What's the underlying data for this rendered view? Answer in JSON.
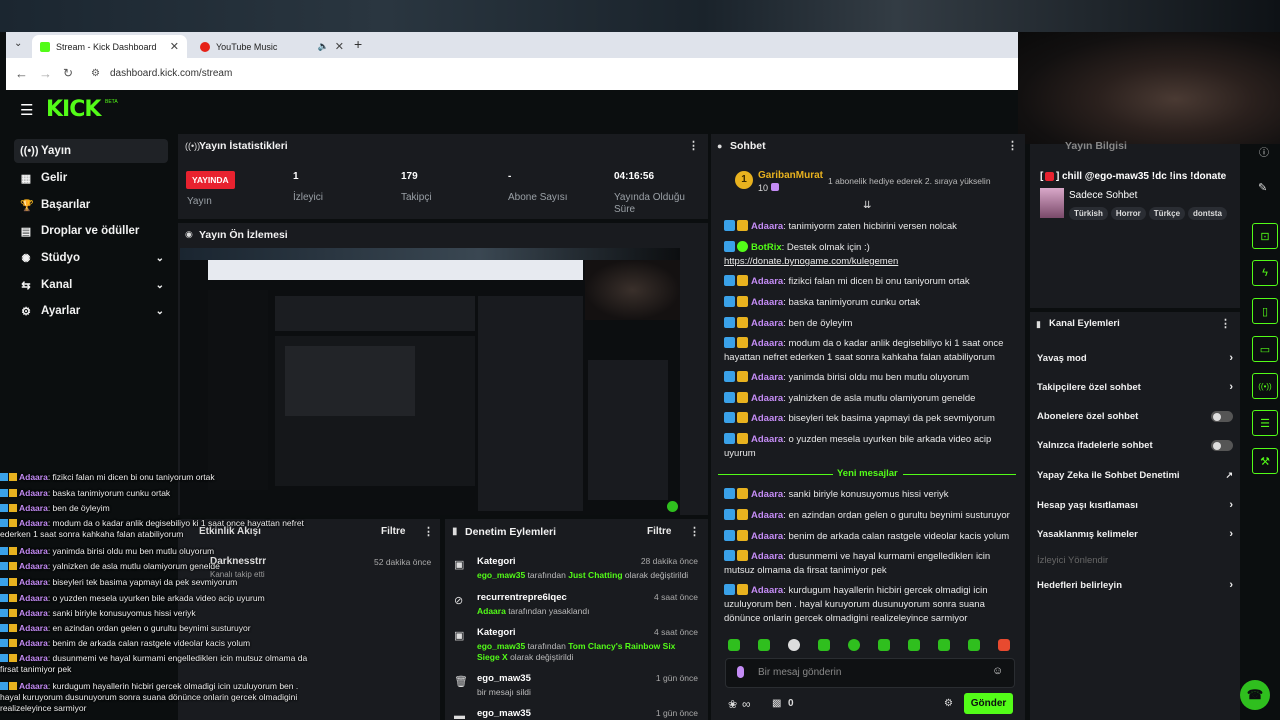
{
  "browser": {
    "tabs": [
      {
        "title": "Stream - Kick Dashboard"
      },
      {
        "title": "YouTube Music"
      }
    ],
    "new_tab": "+",
    "url": "dashboard.kick.com/stream"
  },
  "topbar": {
    "logo": "KICK",
    "beta": "BETA"
  },
  "sidebar": {
    "items": [
      {
        "label": "Yayın"
      },
      {
        "label": "Gelir"
      },
      {
        "label": "Başarılar"
      },
      {
        "label": "Droplar ve ödüller"
      },
      {
        "label": "Stüdyo"
      },
      {
        "label": "Kanal"
      },
      {
        "label": "Ayarlar"
      }
    ]
  },
  "stats": {
    "title": "Yayın İstatistikleri",
    "live": "YAYINDA",
    "live_label": "Yayın",
    "viewers": "1",
    "viewers_label": "İzleyici",
    "followers": "179",
    "followers_label": "Takipçi",
    "subs": "-",
    "subs_label": "Abone Sayısı",
    "uptime": "04:16:56",
    "uptime_label": "Yayında Olduğu Süre"
  },
  "preview": {
    "title": "Yayın Ön İzlemesi"
  },
  "activity": {
    "filter": "Filtre",
    "title_overlay": "Etkinlik Akışı",
    "item_user": "Darknesstrr",
    "item_desc": "Kanalı takip etti",
    "item_time": "52 dakika önce"
  },
  "moderation": {
    "title": "Denetim Eylemleri",
    "filter": "Filtre",
    "items": [
      {
        "title": "Kategori",
        "time": "28 dakika önce",
        "user": "ego_maw35",
        "mid": " tarafından ",
        "value": "Just Chatting",
        "tail": " olarak değiştirildi"
      },
      {
        "title": "recurrentrepre6lqec",
        "time": "4 saat önce",
        "user": "Adaara",
        "mid": " tarafından yasaklandı",
        "value": "",
        "tail": ""
      },
      {
        "title": "Kategori",
        "time": "4 saat önce",
        "user": "ego_maw35",
        "mid": " tarafından ",
        "value": "Tom Clancy's Rainbow Six Siege X",
        "tail": " olarak değiştirildi"
      },
      {
        "title": "ego_maw35",
        "time": "1 gün önce",
        "user": "",
        "mid": "bir mesajı sildi",
        "value": "",
        "tail": ""
      },
      {
        "title": "ego_maw35",
        "time": "1 gün önce",
        "user": "",
        "mid": "",
        "value": "",
        "tail": ""
      }
    ]
  },
  "chat": {
    "title": "Sohbet",
    "pinned_user": "GaribanMurat",
    "pinned_count": "10",
    "pinned_rank": "1",
    "pinned_text": "1 abonelik hediye ederek 2. sıraya yükselin",
    "messages": [
      {
        "user": "Adaara",
        "text": ": tanimiyorm zaten hicbirini versen nolcak"
      },
      {
        "user": "BotRix",
        "text": ": Destek olmak için :) ",
        "link": "https://donate.bynogame.com/kulegemen"
      },
      {
        "user": "Adaara",
        "text": ": fizikci falan mi dicen bi onu taniyorum ortak"
      },
      {
        "user": "Adaara",
        "text": ": baska tanimiyorum cunku ortak"
      },
      {
        "user": "Adaara",
        "text": ": ben de öyleyim"
      },
      {
        "user": "Adaara",
        "text": ": modum da o kadar anlik degisebiliyo ki 1 saat once hayattan nefret ederken 1 saat sonra kahkaha falan atabiliyorum"
      },
      {
        "user": "Adaara",
        "text": ": yanimda birisi oldu mu ben mutlu oluyorum"
      },
      {
        "user": "Adaara",
        "text": ": yalnizken de asla mutlu olamiyorum genelde"
      },
      {
        "user": "Adaara",
        "text": ": biseyleri tek basima yapmayi da pek sevmiyorum"
      },
      {
        "user": "Adaara",
        "text": ": o yuzden mesela uyurken bile arkada video acip uyurum"
      }
    ],
    "new_messages": "Yeni mesajlar",
    "new": [
      {
        "user": "Adaara",
        "text": ": sanki biriyle konusuyomus hissi veriyk"
      },
      {
        "user": "Adaara",
        "text": ": en azindan ordan gelen o gurultu beynimi susturuyor"
      },
      {
        "user": "Adaara",
        "text": ": benim de arkada calan rastgele videolar kacis yolum"
      },
      {
        "user": "Adaara",
        "text": ": dusunmemi ve hayal kurmami engellediklerı icin mutsuz olmama da firsat tanimiyor pek"
      },
      {
        "user": "Adaara",
        "text": ": kurdugum hayallerin hicbiri gercek olmadigi icin uzuluyorum ben . hayal kuruyorum dusunuyorum sonra suana dönünce onlarin gercek olmadigini realizeleyince sarmiyor"
      }
    ],
    "input_placeholder": "Bir mesaj gönderin",
    "points": "∞",
    "gifts": "0",
    "send": "Gönder"
  },
  "stream_info": {
    "title_partial": "Yayın Bilgisi",
    "stream_title": "chill @ego-maw35 !dc !ins !donate",
    "category": "Sadece Sohbet",
    "tags": [
      "Türkish",
      "Horror",
      "Türkçe",
      "dontsta"
    ]
  },
  "channel_actions": {
    "title": "Kanal Eylemleri",
    "items": [
      {
        "label": "Yavaş mod",
        "kind": "chevron"
      },
      {
        "label": "Takipçilere özel sohbet",
        "kind": "chevron"
      },
      {
        "label": "Abonelere özel sohbet",
        "kind": "toggle"
      },
      {
        "label": "Yalnızca ifadelerle sohbet",
        "kind": "toggle"
      },
      {
        "label": "Yapay Zeka ile Sohbet Denetimi",
        "kind": "external"
      },
      {
        "label": "Hesap yaşı kısıtlaması",
        "kind": "chevron"
      },
      {
        "label": "Yasaklanmış kelimeler",
        "kind": "chevron"
      },
      {
        "label": "İzleyici Yönlendir",
        "kind": "disabled"
      },
      {
        "label": "Hedefleri belirleyin",
        "kind": "chevron"
      }
    ]
  },
  "overlay_chat": [
    {
      "user": "Adaara",
      "text": ": fizikci falan mi dicen bi onu taniyorum ortak"
    },
    {
      "user": "Adaara",
      "text": ": baska tanimiyorum cunku ortak"
    },
    {
      "user": "Adaara",
      "text": ": ben de öyleyim"
    },
    {
      "user": "Adaara",
      "text": ": modum da o kadar anlik degisebiliyo ki 1 saat once hayattan nefret ederken 1 saat sonra kahkaha falan atabiliyorum"
    },
    {
      "user": "Adaara",
      "text": ": yanimda birisi oldu mu ben mutlu oluyorum"
    },
    {
      "user": "Adaara",
      "text": ": yalnizken de asla mutlu olamiyorum genelde"
    },
    {
      "user": "Adaara",
      "text": ": biseyleri tek basima yapmayi da pek sevmiyorum"
    },
    {
      "user": "Adaara",
      "text": ": o yuzden mesela uyurken bile arkada video acip uyurum"
    },
    {
      "user": "Adaara",
      "text": ": sanki biriyle konusuyomus hissi veriyk"
    },
    {
      "user": "Adaara",
      "text": ": en azindan ordan gelen o gurultu beynimi susturuyor"
    },
    {
      "user": "Adaara",
      "text": ": benim de arkada calan rastgele videolar kacis yolum"
    },
    {
      "user": "Adaara",
      "text": ": dusunmemi ve hayal kurmami engellediklerı icin mutsuz olmama da firsat tanimiyor pek"
    },
    {
      "user": "Adaara",
      "text": ": kurdugum hayallerin hicbiri gercek olmadigi icin uzuluyorum ben . hayal kuruyorum dusunuyorum sonra suana dönünce onlarin gercek olmadigini realizeleyince sarmiyor"
    }
  ],
  "colors": {
    "accent": "#53fc18",
    "live": "#e8222f",
    "username": "#c48cf5",
    "panel": "#191b1f"
  }
}
